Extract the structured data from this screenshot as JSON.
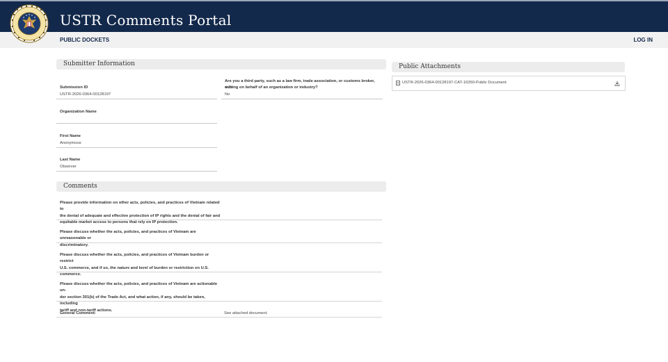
{
  "header": {
    "site_title": "USTR Comments Portal",
    "seal_icon": "presidential-seal-icon",
    "background_color": "#13294b"
  },
  "nav": {
    "public_dockets": "PUBLIC DOCKETS",
    "log_in": "LOG IN"
  },
  "submitter": {
    "section_title": "Submitter Information",
    "submission_id": {
      "label": "Submission ID",
      "value": "USTR-2026-0364-00128197"
    },
    "organization_name": {
      "label": "Organization Name",
      "value": ""
    },
    "first_name": {
      "label": "First Name",
      "value": "Anonymous"
    },
    "last_name": {
      "label": "Last Name",
      "value": "Observer"
    },
    "third_party": {
      "label_line1": "Are you a third party, such as a law firm, trade association, or customs broker, sub-",
      "label_line2": "mitting on behalf of an organization or industry?",
      "value": "No"
    }
  },
  "comments": {
    "section_title": "Comments",
    "questions": [
      {
        "lines": [
          "Please provide information on other acts, policies, and practices of Vietnam related to",
          "the denial of adequate and effective protection of IP rights and the denial of fair and",
          "equitable market access to persons that rely on IP protection."
        ]
      },
      {
        "lines": [
          "Please discuss whether the acts, policies, and practices of Vietnam are unreasonable or",
          "discriminatory."
        ]
      },
      {
        "lines": [
          "Please discuss whether the acts, policies, and practices of Vietnam burden or restrict",
          "U.S. commerce, and if so, the nature and level of burden or restriction on U.S.",
          "commerce."
        ]
      },
      {
        "lines": [
          "Please discuss whether the acts, policies, and practices of Vietnam are actionable un-",
          "der section 301(b) of the Trade Act, and what action, if any, should be taken, including",
          "tariff and non-tariff actions."
        ]
      }
    ],
    "general_comment_label": "General Comment:",
    "general_comment_value": "See attached document."
  },
  "attachments": {
    "section_title": "Public Attachments",
    "items": [
      {
        "name": "USTR-2026-0364-00128197-CAT-16350-Public Document",
        "icon": "document-icon",
        "action_icon": "download-icon"
      }
    ]
  }
}
